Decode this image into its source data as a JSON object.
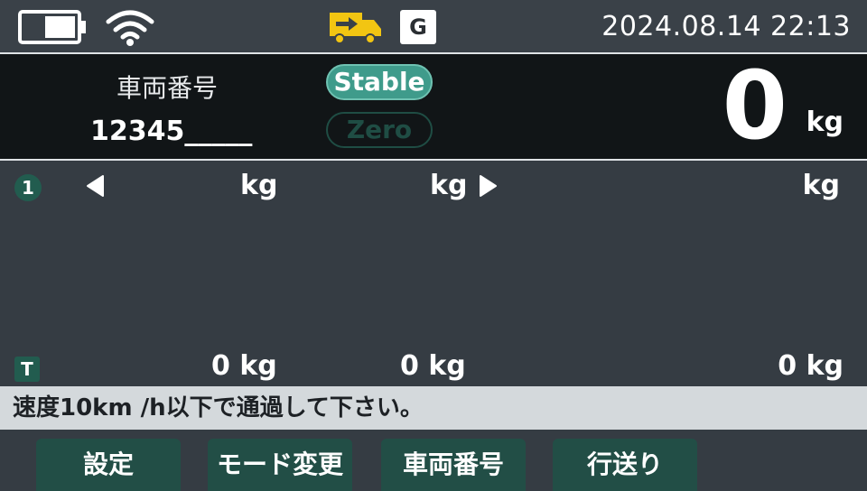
{
  "status_bar": {
    "battery_icon": "battery-half-icon",
    "wifi_icon": "wifi-icon",
    "truck_icon": "truck-arrow-icon",
    "g_badge": "G",
    "datetime": "2024.08.14  22:13"
  },
  "info_panel": {
    "vehicle_label": "車両番号",
    "vehicle_number": "12345_____",
    "stable_label": "Stable",
    "zero_label": "Zero",
    "weight_value": "0",
    "weight_unit": "kg"
  },
  "axle_row": {
    "index": "1",
    "left_arrow_icon": "triangle-left-icon",
    "right_arrow_icon": "triangle-right-icon",
    "units": [
      "kg",
      "kg",
      "kg"
    ]
  },
  "total_row": {
    "badge": "T",
    "values": [
      "0 kg",
      "0 kg",
      "0 kg"
    ]
  },
  "message": "速度10km /h以下で通過して下さい。",
  "footer_buttons": [
    {
      "label": "設定"
    },
    {
      "label": "モード変更"
    },
    {
      "label": "車両番号"
    },
    {
      "label": "行送り"
    }
  ],
  "colors": {
    "accent_green": "#3f9b8b",
    "button_green": "#224e46",
    "truck_yellow": "#f2c512"
  }
}
